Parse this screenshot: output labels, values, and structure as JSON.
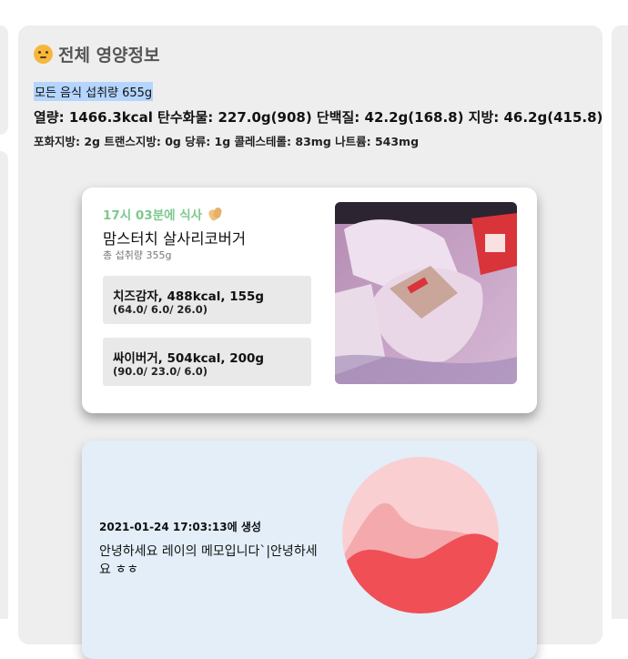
{
  "panel": {
    "title": "전체 영양정보",
    "title_icon": "thinking-face-emoji",
    "intake": "모든 음식 섭취량 655g",
    "totals": "열량: 1466.3kcal 탄수화물: 227.0g(908) 단백질: 42.2g(168.8) 지방: 46.2g(415.8)",
    "details": "포화지방: 2g 트랜스지방: 0g 당류: 1g 콜레스테롤: 83mg 나트륨: 543mg"
  },
  "meal": {
    "time": "17시 03분에 식사",
    "time_icon": "clapping-hands-emoji",
    "name": "맘스터치 살사리코버거",
    "total": "총 섭취량 355g",
    "items": [
      {
        "name": "치즈감자, 488kcal, 155g",
        "macros": "(64.0/ 6.0/ 26.0)"
      },
      {
        "name": "싸이버거, 504kcal, 200g",
        "macros": "(90.0/ 23.0/ 6.0)"
      }
    ],
    "photo_icon": "food-photo"
  },
  "memo": {
    "created": "2021-01-24 17:03:13에 생성",
    "text": "안녕하세요 레이의 메모입니다`|안녕하세요 ㅎㅎ",
    "graphic_icon": "wave-circle-graphic"
  },
  "colors": {
    "panel_bg": "#eeeeef",
    "meal_time": "#7cc98e",
    "memo_bg": "#e3eef8",
    "wave_red": "#ef4f55",
    "wave_pink": "#f9cfd2"
  }
}
